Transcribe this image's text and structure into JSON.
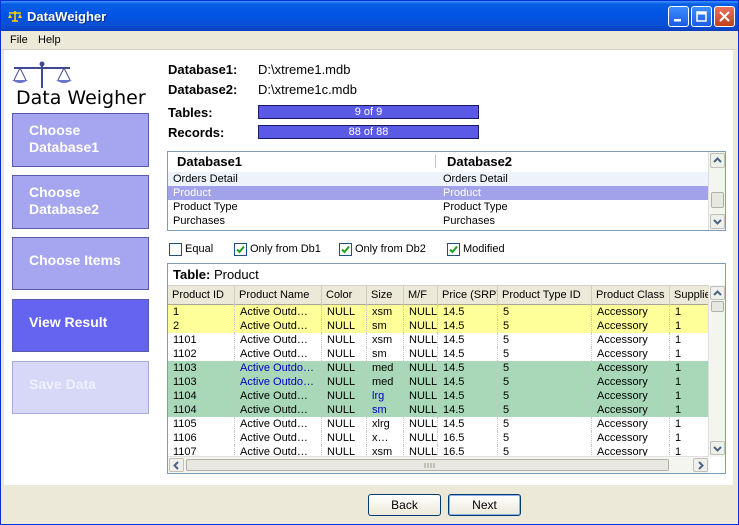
{
  "window": {
    "title": "DataWeigher"
  },
  "menu": [
    "File",
    "Help"
  ],
  "logo": {
    "text": "Data Weigher"
  },
  "sidebar": [
    {
      "label": "Choose Database1",
      "state": "normal"
    },
    {
      "label": "Choose Database2",
      "state": "normal"
    },
    {
      "label": "Choose Items",
      "state": "normal"
    },
    {
      "label": "View Result",
      "state": "active"
    },
    {
      "label": "Save Data",
      "state": "disabled"
    }
  ],
  "info": {
    "db1_label": "Database1:",
    "db1_value": "D:\\xtreme1.mdb",
    "db2_label": "Database2:",
    "db2_value": "D:\\xtreme1c.mdb",
    "tables_label": "Tables:",
    "tables_value": "9 of 9",
    "tables_progress": 1.0,
    "records_label": "Records:",
    "records_value": "88 of 88",
    "records_progress": 1.0
  },
  "db_list": {
    "headers": [
      "Database1",
      "Database2"
    ],
    "rows": [
      [
        "Orders Detail",
        "Orders Detail"
      ],
      [
        "Product",
        "Product"
      ],
      [
        "Product Type",
        "Product Type"
      ],
      [
        "Purchases",
        "Purchases"
      ]
    ],
    "selected_row": 1
  },
  "filters": [
    {
      "label": "Equal",
      "checked": false
    },
    {
      "label": "Only from Db1",
      "checked": true
    },
    {
      "label": "Only from Db2",
      "checked": true
    },
    {
      "label": "Modified",
      "checked": true
    }
  ],
  "table": {
    "title_label": "Table:",
    "title_value": "Product",
    "columns": [
      "Product ID",
      "Product Name",
      "Color",
      "Size",
      "M/F",
      "Price (SRP)",
      "Product Type ID",
      "Product Class",
      "Supplie"
    ],
    "rows": [
      {
        "bg": "#ffff99",
        "cells": [
          "1",
          "Active Outd…",
          "NULL",
          "xsm",
          "NULL",
          "14.5",
          "5",
          "Accessory",
          "1"
        ]
      },
      {
        "bg": "#ffff99",
        "cells": [
          "2",
          "Active Outd…",
          "NULL",
          "sm",
          "NULL",
          "14.5",
          "5",
          "Accessory",
          "1"
        ]
      },
      {
        "bg": "#ffffff",
        "cells": [
          "1101",
          "Active Outd…",
          "NULL",
          "xsm",
          "NULL",
          "14.5",
          "5",
          "Accessory",
          "1"
        ]
      },
      {
        "bg": "#ffffff",
        "cells": [
          "1102",
          "Active Outd…",
          "NULL",
          "sm",
          "NULL",
          "14.5",
          "5",
          "Accessory",
          "1"
        ]
      },
      {
        "bg": "#a8d8b8",
        "cells": [
          "1103",
          "Active Outdo…",
          "NULL",
          "med",
          "NULL",
          "14.5",
          "5",
          "Accessory",
          "1"
        ],
        "blue": [
          1
        ]
      },
      {
        "bg": "#a8d8b8",
        "cells": [
          "1103",
          "Active Outdo…",
          "NULL",
          "med",
          "NULL",
          "14.5",
          "5",
          "Accessory",
          "1"
        ],
        "blue": [
          1
        ]
      },
      {
        "bg": "#a8d8b8",
        "cells": [
          "1104",
          "Active Outd…",
          "NULL",
          "lrg",
          "NULL",
          "14.5",
          "5",
          "Accessory",
          "1"
        ],
        "blue": [
          3
        ]
      },
      {
        "bg": "#a8d8b8",
        "cells": [
          "1104",
          "Active Outd…",
          "NULL",
          "sm",
          "NULL",
          "14.5",
          "5",
          "Accessory",
          "1"
        ],
        "blue": [
          3
        ]
      },
      {
        "bg": "#ffffff",
        "cells": [
          "1105",
          "Active Outd…",
          "NULL",
          "xlrg",
          "NULL",
          "14.5",
          "5",
          "Accessory",
          "1"
        ]
      },
      {
        "bg": "#ffffff",
        "cells": [
          "1106",
          "Active Outd…",
          "NULL",
          "x…",
          "NULL",
          "16.5",
          "5",
          "Accessory",
          "1"
        ]
      },
      {
        "bg": "#ffffff",
        "cells": [
          "1107",
          "Active Outd…",
          "NULL",
          "xsm",
          "NULL",
          "16.5",
          "5",
          "Accessory",
          "1"
        ]
      }
    ]
  },
  "buttons": {
    "back": "Back",
    "next": "Next"
  },
  "colors": {
    "selection": "#a2a2ea",
    "added": "#ffff99",
    "modified": "#a8d8b8",
    "modified_text": "#0000c0",
    "sidebar": "#a6a6f0",
    "sidebar_active": "#6464f0"
  }
}
